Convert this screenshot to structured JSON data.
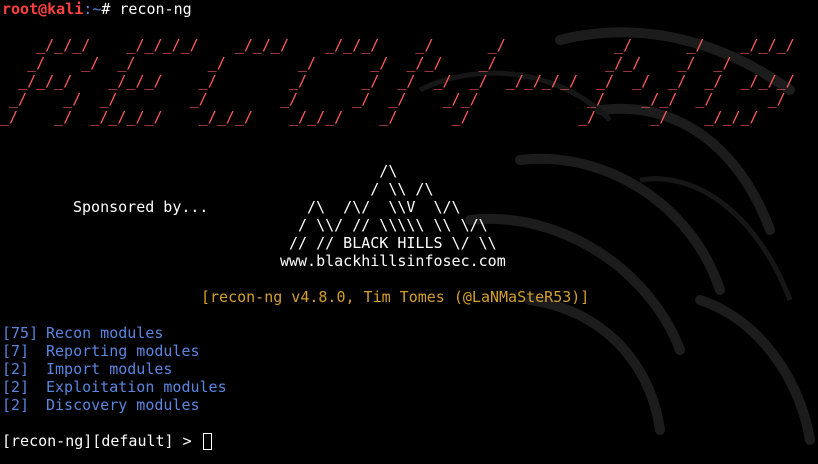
{
  "terminal": {
    "prompt_user_host": "root@kali",
    "prompt_path": ":~",
    "prompt_symbol": "#",
    "command": "recon-ng"
  },
  "banner": {
    "lines": [
      "    _/_/_/    _/_/_/_/    _/_/_/    _/_/_/    _/      _/            _/      _/    _/_/_/",
      "   _/    _/  _/        _/        _/      _/  _/_/    _/            _/_/    _/  _/       ",
      "  _/_/_/    _/_/_/    _/        _/      _/  _/  _/  _/  _/_/_/_/  _/  _/  _/  _/  _/_/_/",
      " _/    _/  _/        _/        _/      _/  _/    _/_/            _/    _/_/  _/      _/ ",
      "_/    _/  _/_/_/_/    _/_/_/    _/_/_/    _/      _/            _/      _/    _/_/_/    "
    ]
  },
  "sponsor": {
    "label": "Sponsored by...",
    "art_lines": [
      "                                          /\\",
      "                                         / \\\\ /\\",
      "                                  /\\  /\\/  \\\\V  \\/\\",
      "                                 / \\\\/ // \\\\\\\\\\ \\\\ \\/\\",
      "                                // // BLACK HILLS \\/ \\\\",
      "                               www.blackhillsinfosec.com"
    ]
  },
  "version_line": "[recon-ng v4.8.0, Tim Tomes (@LaNMaSteR53)]",
  "modules": [
    {
      "count": "[75]",
      "label": "Recon modules"
    },
    {
      "count": "[7]",
      "label": "Reporting modules"
    },
    {
      "count": "[2]",
      "label": "Import modules"
    },
    {
      "count": "[2]",
      "label": "Exploitation modules"
    },
    {
      "count": "[2]",
      "label": "Discovery modules"
    }
  ],
  "shell_prompt": "[recon-ng][default] >",
  "colors": {
    "background": "#000000",
    "prompt_red": "#ff4040",
    "banner_red": "#ff5b5b",
    "module_blue": "#5a86e0",
    "version_yellow": "#d4a02a",
    "text_white": "#ffffff"
  }
}
